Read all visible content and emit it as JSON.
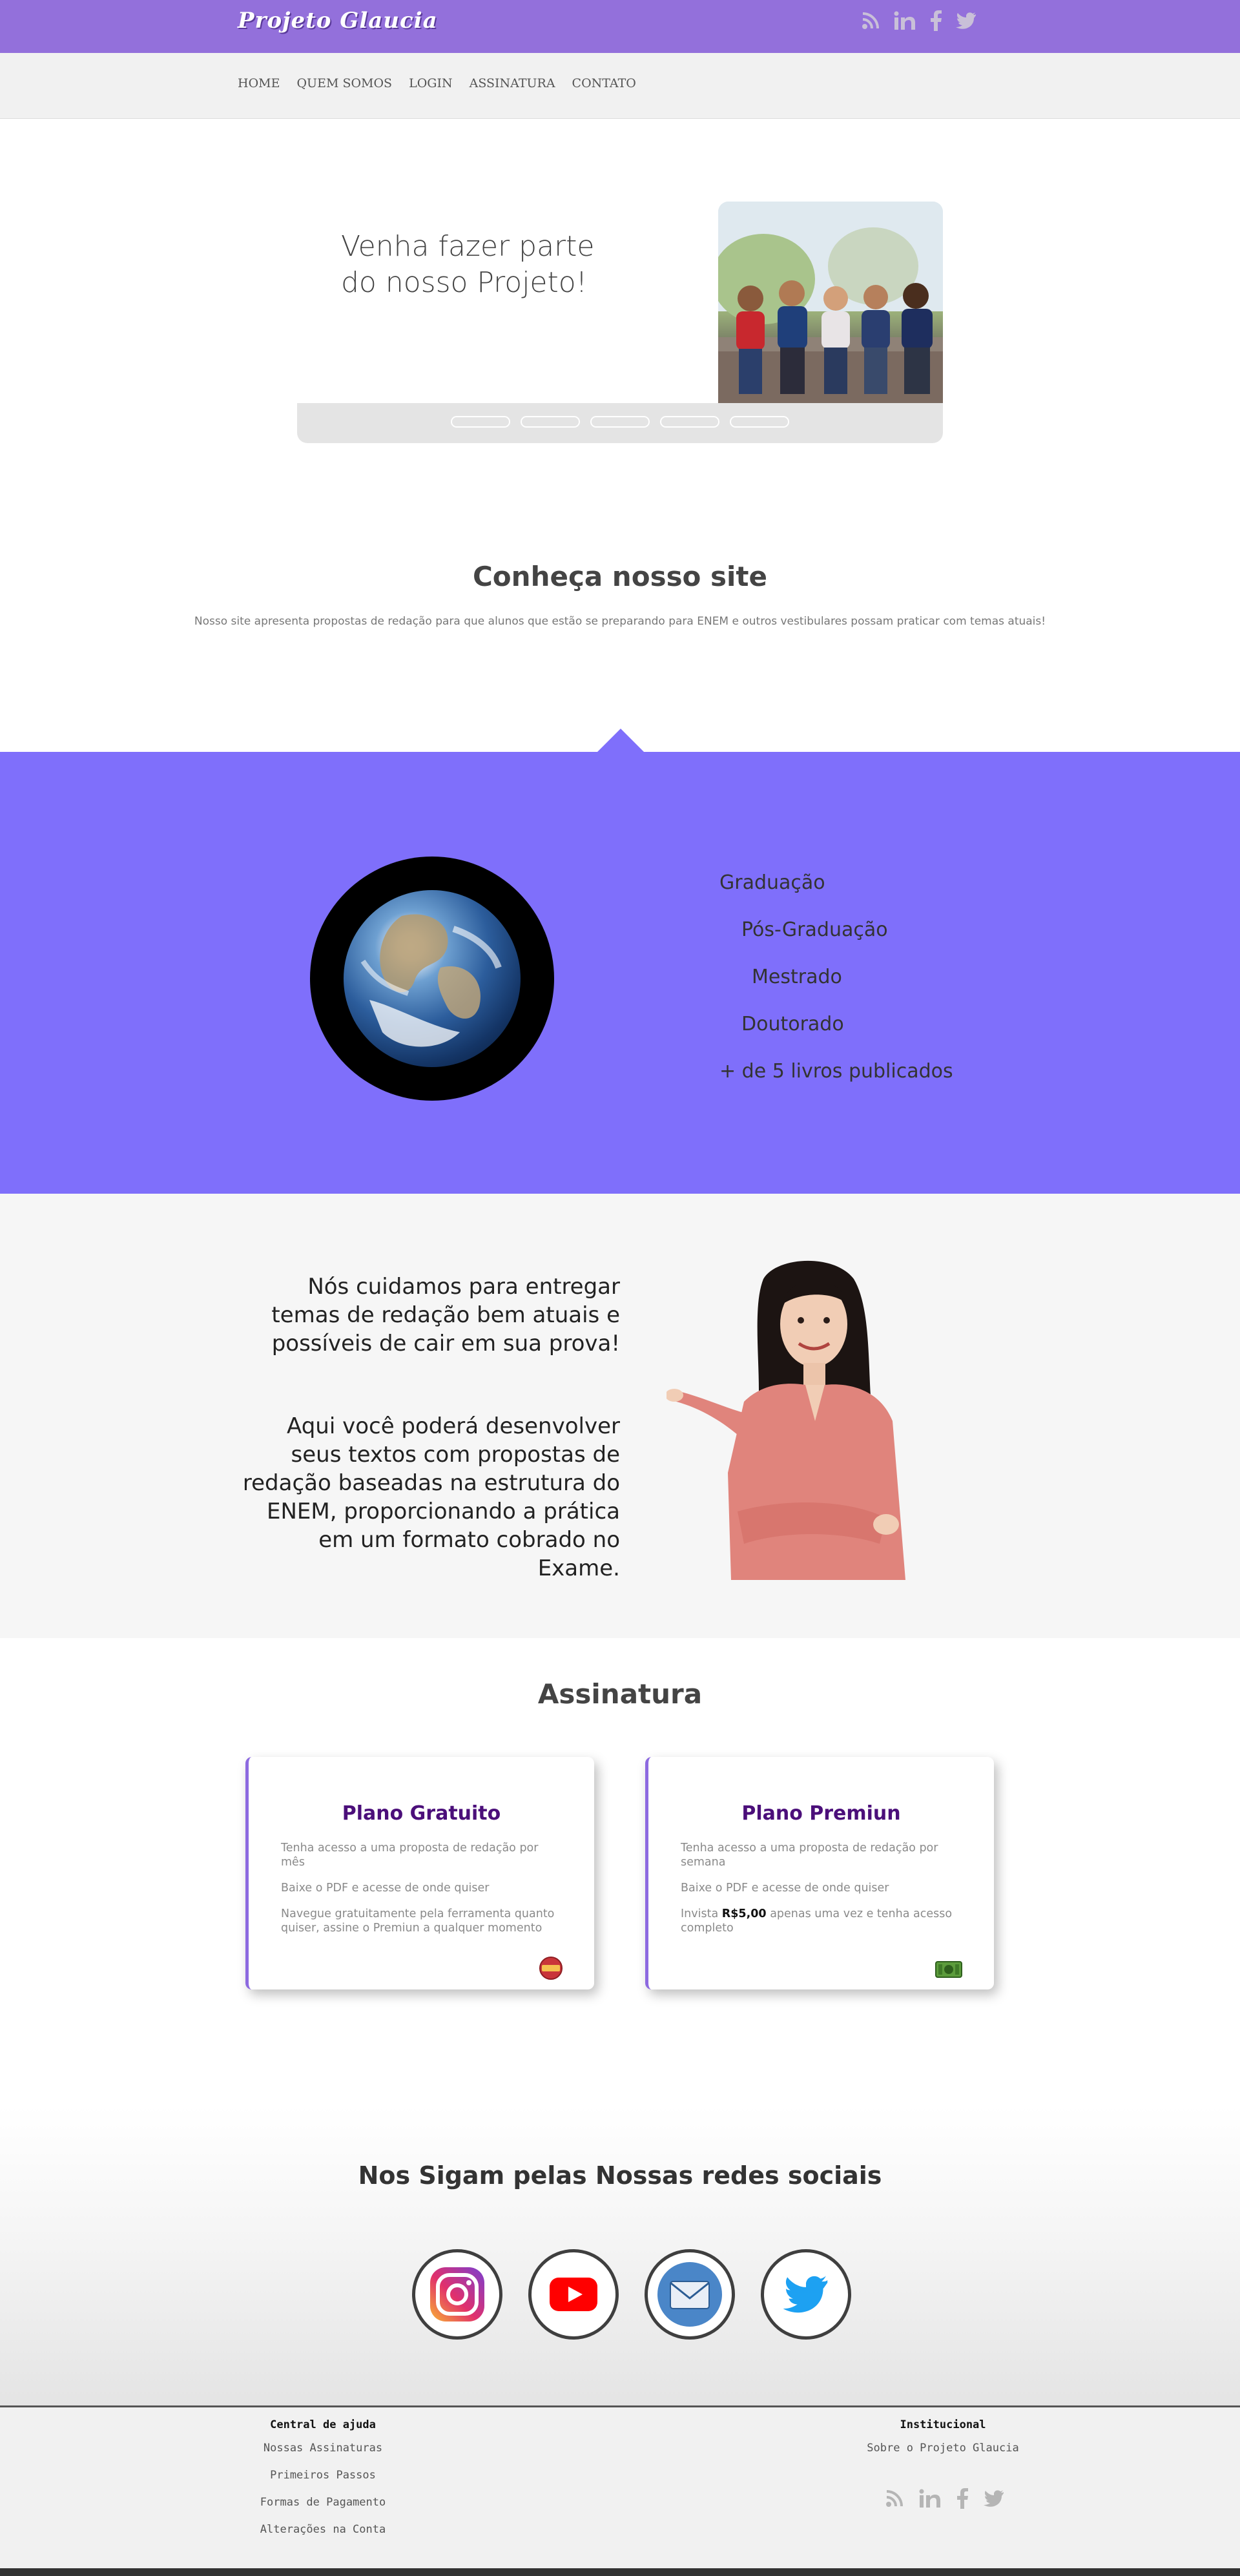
{
  "header": {
    "logo": "Projeto Glaucia",
    "social_icons": [
      "rss-icon",
      "linkedin-icon",
      "facebook-icon",
      "twitter-icon"
    ]
  },
  "nav": {
    "items": [
      {
        "label": "HOME"
      },
      {
        "label": "QUEM SOMOS"
      },
      {
        "label": "LOGIN"
      },
      {
        "label": "ASSINATURA"
      },
      {
        "label": "CONTATO"
      }
    ]
  },
  "hero": {
    "headline": "Venha fazer parte do nosso Projeto!",
    "slide_count": 5
  },
  "intro": {
    "title": "Conheça nosso site",
    "subtitle": "Nosso site apresenta propostas de redação para que alunos que estão se preparando para ENEM e outros vestibulares possam praticar com temas atuais!"
  },
  "credentials": {
    "items": [
      "Graduação",
      "Pós-Graduação",
      "Mestrado",
      "Doutorado",
      "+ de 5 livros publicados"
    ]
  },
  "feature": {
    "paragraph_1": "Nós cuidamos para entregar temas de redação bem atuais e possíveis de cair em sua prova!",
    "paragraph_2": "Aqui você poderá desenvolver seus textos com propostas de redação baseadas na estrutura do ENEM, proporcionando a prática em um formato cobrado no Exame."
  },
  "subscription": {
    "title": "Assinatura",
    "free": {
      "title": "Plano Gratuito",
      "items": [
        "Tenha acesso a uma proposta de redação por mês",
        "Baixe o PDF e acesse de onde quiser",
        "Navegue gratuitamente pela ferramenta quanto quiser, assine o Premiun a qualquer momento"
      ],
      "badge_icon": "free-badge-icon"
    },
    "premium": {
      "title": "Plano Premiun",
      "item_1": "Tenha acesso a uma proposta de redação por semana",
      "item_2": "Baixe o PDF e acesse de onde quiser",
      "item_3_prefix": "Invista",
      "item_3_price": "R$5,00",
      "item_3_suffix": "apenas uma vez e tenha acesso completo",
      "badge_icon": "money-icon"
    }
  },
  "social": {
    "title": "Nos Sigam pelas Nossas redes sociais",
    "icons": [
      "instagram-icon",
      "youtube-icon",
      "email-icon",
      "twitter-icon"
    ]
  },
  "footer": {
    "help": {
      "title": "Central de ajuda",
      "links": [
        "Nossas Assinaturas",
        "Primeiros Passos",
        "Formas de Pagamento",
        "Alterações na Conta"
      ]
    },
    "institutional": {
      "title": "Institucional",
      "links": [
        "Sobre o Projeto Glaucia"
      ]
    },
    "social_icons": [
      "rss-icon",
      "linkedin-icon",
      "facebook-icon",
      "twitter-icon"
    ]
  },
  "colors": {
    "topbar": "#9370db",
    "purple_section": "#7f6ffb",
    "plan_title": "#4b0f7a"
  }
}
